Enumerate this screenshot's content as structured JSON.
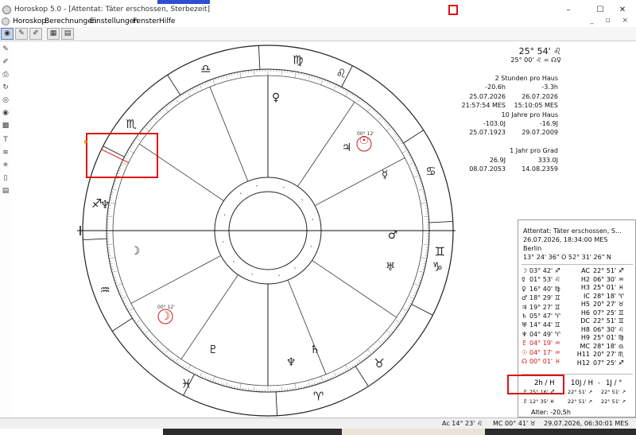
{
  "window": {
    "title": "Horoskop 5.0 - [Attentat: Täter erschossen, Sterbezeit]",
    "minimize": "–",
    "maximize": "☐",
    "close": "✕"
  },
  "menu": [
    "Horoskop",
    "Berechnungen",
    "Einstellungen",
    "Fenster",
    "Hilfe"
  ],
  "mdi_controls": "_ ▫ ×",
  "chart_header": {
    "line1": "25° 54' ♌",
    "line2": "25° 00' ♌ = ☊♀"
  },
  "directions": {
    "a_title": "2 Stunden pro Haus",
    "a_v1": "-20.6h",
    "a_v2": "-3.3h",
    "a_d1": "25.07.2026",
    "a_d2": "26.07.2026",
    "a_t1": "21:57:54 MES",
    "a_t2": "15:10:05 MES",
    "b_title": "10 Jahre pro Haus",
    "b_v1": "-103.0J",
    "b_v2": "-16.9J",
    "b_d1": "25.07.1923",
    "b_d2": "29.07.2009",
    "c_title": "1 Jahr pro Grad",
    "c_v1": "26.9J",
    "c_v2": "333.0J",
    "c_d1": "08.07.2053",
    "c_d2": "14.08.2359"
  },
  "info": {
    "name": "Attentat: Täter erschossen, S...",
    "datetime": "26.07.2026, 18:34:00 MES",
    "place": "Berlin",
    "coords": "13° 24' 36\" O   52° 31' 26\" N"
  },
  "planets": [
    {
      "glyph": "☽",
      "pos": "03° 42' ♐",
      "color": "#111111"
    },
    {
      "glyph": "☿",
      "pos": "01° 53' ♌",
      "color": "#111111"
    },
    {
      "glyph": "♀",
      "pos": "16° 40' ♍",
      "color": "#111111"
    },
    {
      "glyph": "♂",
      "pos": "18° 29' ♊",
      "color": "#111111"
    },
    {
      "glyph": "♃",
      "pos": "19° 27' ♊",
      "color": "#111111"
    },
    {
      "glyph": "♄",
      "pos": "05° 47' ♈",
      "color": "#111111"
    },
    {
      "glyph": "♅",
      "pos": "14° 44' ♊",
      "color": "#111111"
    },
    {
      "glyph": "♆",
      "pos": "04° 49' ♈",
      "color": "#111111"
    },
    {
      "glyph": "♇",
      "pos": "04° 19' ♒",
      "color": "#d01818"
    },
    {
      "glyph": "☉",
      "pos": "04° 17' ♒",
      "color": "#d01818"
    },
    {
      "glyph": "☊",
      "pos": "00° 01' ♓",
      "color": "#d01818"
    }
  ],
  "houses": [
    {
      "label": "AC",
      "pos": "22° 51' ♐"
    },
    {
      "label": "H2",
      "pos": "06° 30' ♒"
    },
    {
      "label": "H3",
      "pos": "25° 01' ♓"
    },
    {
      "label": "IC",
      "pos": "28° 18' ♈"
    },
    {
      "label": "H5",
      "pos": "20° 27' ♉"
    },
    {
      "label": "H6",
      "pos": "07° 25' ♊"
    },
    {
      "label": "DC",
      "pos": "22° 51' ♊"
    },
    {
      "label": "H8",
      "pos": "06° 30' ♌"
    },
    {
      "label": "H9",
      "pos": "25° 01' ♍"
    },
    {
      "label": "MC",
      "pos": "28° 18' ♎"
    },
    {
      "label": "H11",
      "pos": "20° 27' ♏"
    },
    {
      "label": "H12",
      "pos": "07° 25' ♐"
    }
  ],
  "controls": {
    "mode_2h": "2h / H",
    "dash1": "-",
    "mode_10j": "10J / H",
    "dash2": "-",
    "mode_1j": "1J / °",
    "r1c1": "♇ 25° 16' ♐",
    "r1c2": "22° 51' ↗",
    "r1c3": "22° 51' ↗",
    "r2c1": "♇ 12° 35' ♓",
    "r2c2": "22° 51' ↗",
    "r2c3": "22° 51' ↗",
    "alter": "Alter: -20,5h"
  },
  "chart_labels": {
    "sun_small": "00° 12'",
    "moon_small": "00° 12'"
  },
  "status": {
    "ac": "Ac 14° 23' ♌",
    "mc": "MC 00° 41' ♉",
    "datetime": "29.07.2026, 06:30:01 MES"
  },
  "colors": {
    "highlight": "#e01010",
    "natal_red": "#d01818",
    "accent_blue": "#2f4fd0"
  }
}
